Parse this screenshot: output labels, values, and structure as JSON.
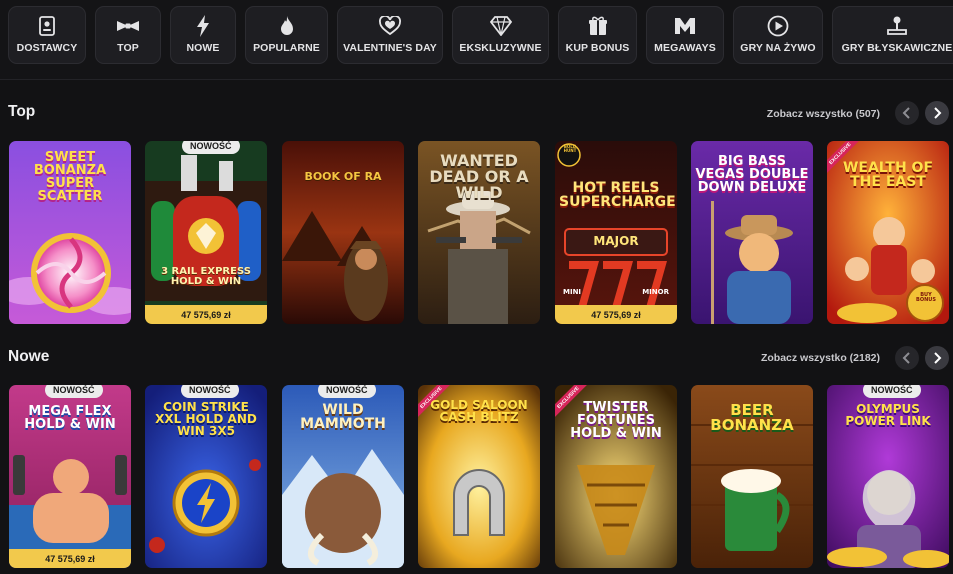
{
  "categories": [
    {
      "label": "DOSTAWCY",
      "icon": "providers-icon"
    },
    {
      "label": "TOP",
      "icon": "bowtie-icon"
    },
    {
      "label": "NOWE",
      "icon": "lightning-icon"
    },
    {
      "label": "POPULARNE",
      "icon": "flame-icon"
    },
    {
      "label": "VALENTINE'S DAY",
      "icon": "heart-icon"
    },
    {
      "label": "EKSKLUZYWNE",
      "icon": "diamond-icon"
    },
    {
      "label": "KUP BONUS",
      "icon": "gift-icon"
    },
    {
      "label": "MEGAWAYS",
      "icon": "megaways-icon"
    },
    {
      "label": "GRY NA ŻYWO",
      "icon": "play-icon"
    },
    {
      "label": "GRY BŁYSKAWICZNE",
      "icon": "joystick-icon"
    }
  ],
  "sections": {
    "top": {
      "title": "Top",
      "see_all": "Zobacz wszystko (507)",
      "games": [
        {
          "title": "SWEET BONANZA SUPER SCATTER"
        },
        {
          "title": "3 RAIL EXPRESS HOLD & WIN",
          "badge": "NOWOŚĆ",
          "jackpot": "47 575,69 zł"
        },
        {
          "title": "BOOK OF RA"
        },
        {
          "title": "WANTED DEAD OR A WILD"
        },
        {
          "title": "HOT REELS SUPERCHARGED",
          "logo": "BOLD HUNT",
          "extra1": "MAJOR",
          "extra2": "MINI",
          "extra3": "MINOR",
          "jackpot": "47 575,69 zł"
        },
        {
          "title": "BIG BASS VEGAS DOUBLE DOWN DELUXE"
        },
        {
          "title": "WEALTH OF THE EAST",
          "ribbon": "EXCLUSIVE",
          "extra1": "BUY BONUS"
        }
      ]
    },
    "new": {
      "title": "Nowe",
      "see_all": "Zobacz wszystko (2182)",
      "games": [
        {
          "title": "MEGA FLEX HOLD & WIN",
          "badge": "NOWOŚĆ",
          "jackpot": "47 575,69 zł"
        },
        {
          "title": "COIN STRIKE XXL HOLD AND WIN 3X5",
          "badge": "NOWOŚĆ"
        },
        {
          "title": "WILD MAMMOTH",
          "badge": "NOWOŚĆ"
        },
        {
          "title": "GOLD SALOON CASH BLITZ",
          "ribbon": "EXCLUSIVE"
        },
        {
          "title": "TWISTER FORTUNES HOLD & WIN",
          "ribbon": "EXCLUSIVE"
        },
        {
          "title": "BEER BONANZA"
        },
        {
          "title": "OLYMPUS POWER LINK",
          "badge": "NOWOŚĆ"
        }
      ]
    }
  },
  "colors": {
    "background": "#121214",
    "jackpot_bar": "#f2c94c",
    "badge": "#ececec",
    "exclusive_ribbon": "#d6255a"
  }
}
